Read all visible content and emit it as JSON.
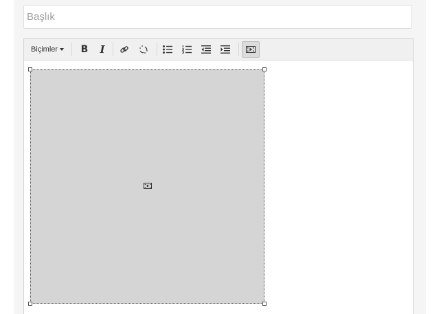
{
  "title_field": {
    "placeholder": "Başlık",
    "value": ""
  },
  "toolbar": {
    "formats_label": "Biçimler",
    "bold_label": "B",
    "italic_label": "I",
    "buttons": [
      {
        "icon": "link-icon"
      },
      {
        "icon": "unlink-icon"
      },
      {
        "icon": "bullet-list-icon"
      },
      {
        "icon": "numbered-list-icon"
      },
      {
        "icon": "outdent-icon"
      },
      {
        "icon": "indent-icon"
      },
      {
        "icon": "media-icon",
        "active": true
      }
    ]
  },
  "content": {
    "media": {
      "icon": "media-icon",
      "fill_color": "#d5d5d5"
    }
  }
}
